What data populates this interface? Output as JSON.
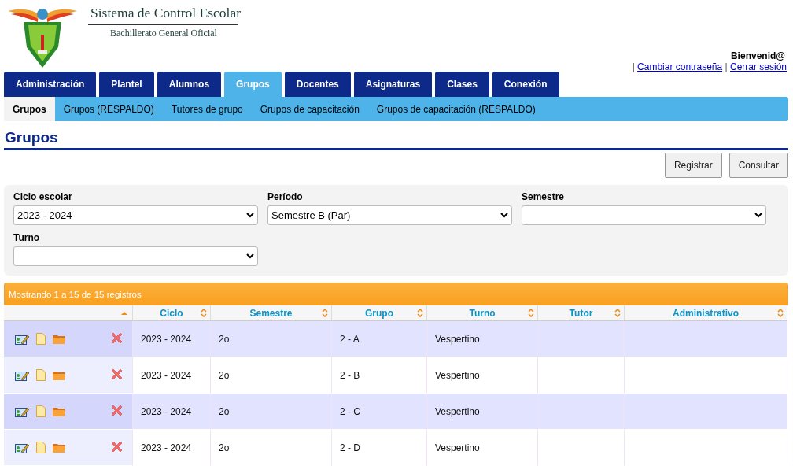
{
  "header": {
    "title": "Sistema de Control Escolar",
    "subtitle": "Bachillerato General Oficial"
  },
  "user": {
    "greeting": "Bienvenid@",
    "separator": "|",
    "links": [
      "Cambiar contraseña",
      "Cerrar sesión"
    ]
  },
  "tabs": [
    {
      "label": "Administración",
      "selected": false
    },
    {
      "label": "Plantel",
      "selected": false
    },
    {
      "label": "Alumnos",
      "selected": false
    },
    {
      "label": "Grupos",
      "selected": true
    },
    {
      "label": "Docentes",
      "selected": false
    },
    {
      "label": "Asignaturas",
      "selected": false
    },
    {
      "label": "Clases",
      "selected": false
    },
    {
      "label": "Conexión",
      "selected": false
    }
  ],
  "subtabs": [
    {
      "label": "Grupos",
      "selected": true
    },
    {
      "label": "Grupos (RESPALDO)",
      "selected": false
    },
    {
      "label": "Tutores de grupo",
      "selected": false
    },
    {
      "label": "Grupos de capacitación",
      "selected": false
    },
    {
      "label": "Grupos de capacitación (RESPALDO)",
      "selected": false
    }
  ],
  "page_title": "Grupos",
  "buttons": [
    "Registrar",
    "Consultar"
  ],
  "filters": [
    {
      "label": "Ciclo escolar",
      "value": "2023 - 2024"
    },
    {
      "label": "Período",
      "value": "Semestre B (Par)"
    },
    {
      "label": "Semestre"
    },
    {
      "label": "Turno"
    }
  ],
  "table": {
    "info": "Mostrando 1 a 15 de 15 registros",
    "columns": [
      "Ciclo",
      "Semestre",
      "Grupo",
      "Turno",
      "Tutor",
      "Administrativo"
    ],
    "rows": [
      {
        "cells": [
          "2023 - 2024",
          "2o",
          "2 - A",
          "Vespertino",
          "",
          ""
        ]
      },
      {
        "cells": [
          "2023 - 2024",
          "2o",
          "2 - B",
          "Vespertino",
          "",
          ""
        ]
      },
      {
        "cells": [
          "2023 - 2024",
          "2o",
          "2 - C",
          "Vespertino",
          "",
          ""
        ]
      },
      {
        "cells": [
          "2023 - 2024",
          "2o",
          "2 - D",
          "Vespertino",
          "",
          ""
        ]
      }
    ]
  }
}
